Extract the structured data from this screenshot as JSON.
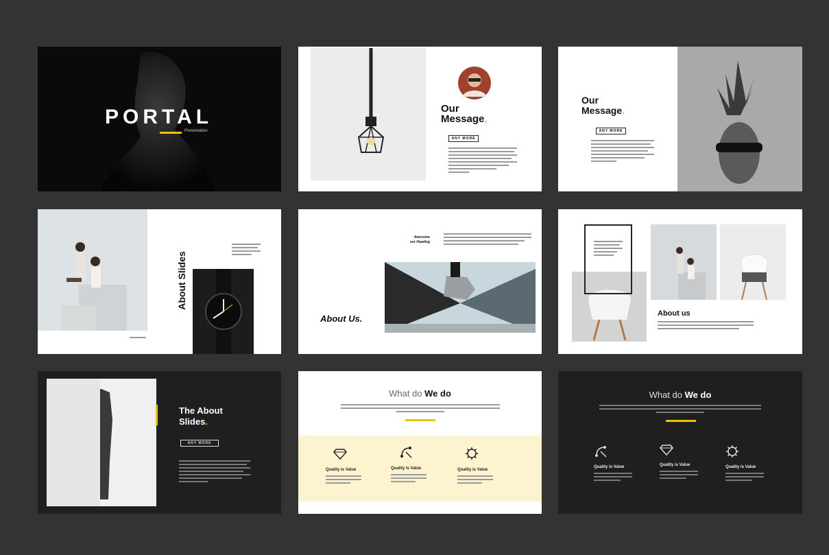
{
  "slides": {
    "s1": {
      "title": "PORTAL",
      "subtitle": "Presentation"
    },
    "s2": {
      "title_line1": "Our",
      "title_line2": "Message",
      "dot": ".",
      "button": "ANY MORE"
    },
    "s3": {
      "title_line1": "Our",
      "title_line2": "Message",
      "dot": ".",
      "button": "ANY MORE"
    },
    "s4": {
      "title": "About Slides"
    },
    "s5": {
      "heading_line1": "Awesome",
      "heading_line2": "our Heading",
      "title": "About Us."
    },
    "s6": {
      "title": "About us"
    },
    "s7": {
      "title_line1": "The About",
      "title_line2": "Slides",
      "dot": ".",
      "button": "ANY MORE"
    },
    "s8": {
      "title_normal": "What do ",
      "title_bold": "We do",
      "items": [
        "Quality is Value",
        "Quality is Value",
        "Quality is Value"
      ]
    },
    "s9": {
      "title_normal": "What do ",
      "title_bold": "We do",
      "items": [
        "Quality is Value",
        "Quality is Value",
        "Quality is Value"
      ]
    }
  },
  "colors": {
    "background": "#333333",
    "accent": "#f2c200",
    "dark_slide": "#1f1f1f",
    "cream_band": "#fdf3cf"
  },
  "icons": [
    "diamond-icon",
    "pen-tool-icon",
    "gear-icon"
  ]
}
